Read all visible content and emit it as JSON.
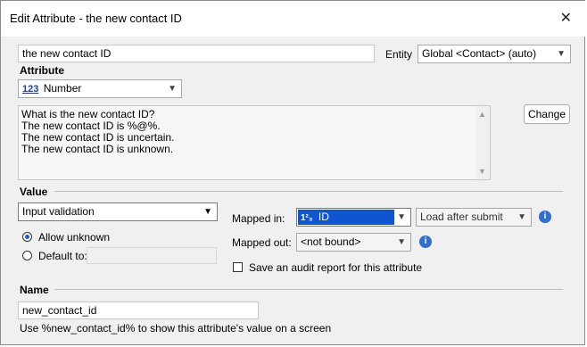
{
  "window": {
    "title": "Edit Attribute - the new contact ID"
  },
  "name_field": {
    "value": "the new contact ID"
  },
  "entity": {
    "label": "Entity",
    "value": "Global <Contact> (auto)"
  },
  "attribute": {
    "section_label": "Attribute",
    "type_icon": "123",
    "type_value": "Number",
    "questions": [
      "What is the new contact ID?",
      "The new contact ID is %@%.",
      "The new contact ID is uncertain.",
      "The new contact ID is unknown."
    ],
    "change_button": "Change"
  },
  "value": {
    "section_label": "Value",
    "validation": "Input validation",
    "allow_unknown": "Allow unknown",
    "default_to": "Default to:",
    "mapped_in_label": "Mapped in:",
    "mapped_in_value": "ID",
    "mapped_in_icon": "1²₃",
    "load_option": "Load after submit",
    "mapped_out_label": "Mapped out:",
    "mapped_out_value": "<not bound>",
    "audit_label": "Save an audit report for this attribute"
  },
  "name": {
    "section_label": "Name",
    "value": "new_contact_id",
    "hint": "Use %new_contact_id% to show this attribute's value on a screen"
  },
  "icons": {
    "close": "close-icon",
    "dropdown": "chevron-down-icon",
    "info": "info-icon",
    "number": "number-type-icon"
  },
  "colors": {
    "selection": "#0f55d0",
    "info": "#2e6fd0"
  }
}
